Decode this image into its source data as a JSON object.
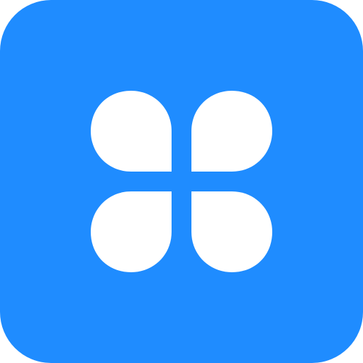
{
  "app_icon": {
    "icon": "four-petal-clover-icon",
    "colors": {
      "background": "#1F8CFF",
      "foreground": "#FFFFFF"
    }
  }
}
